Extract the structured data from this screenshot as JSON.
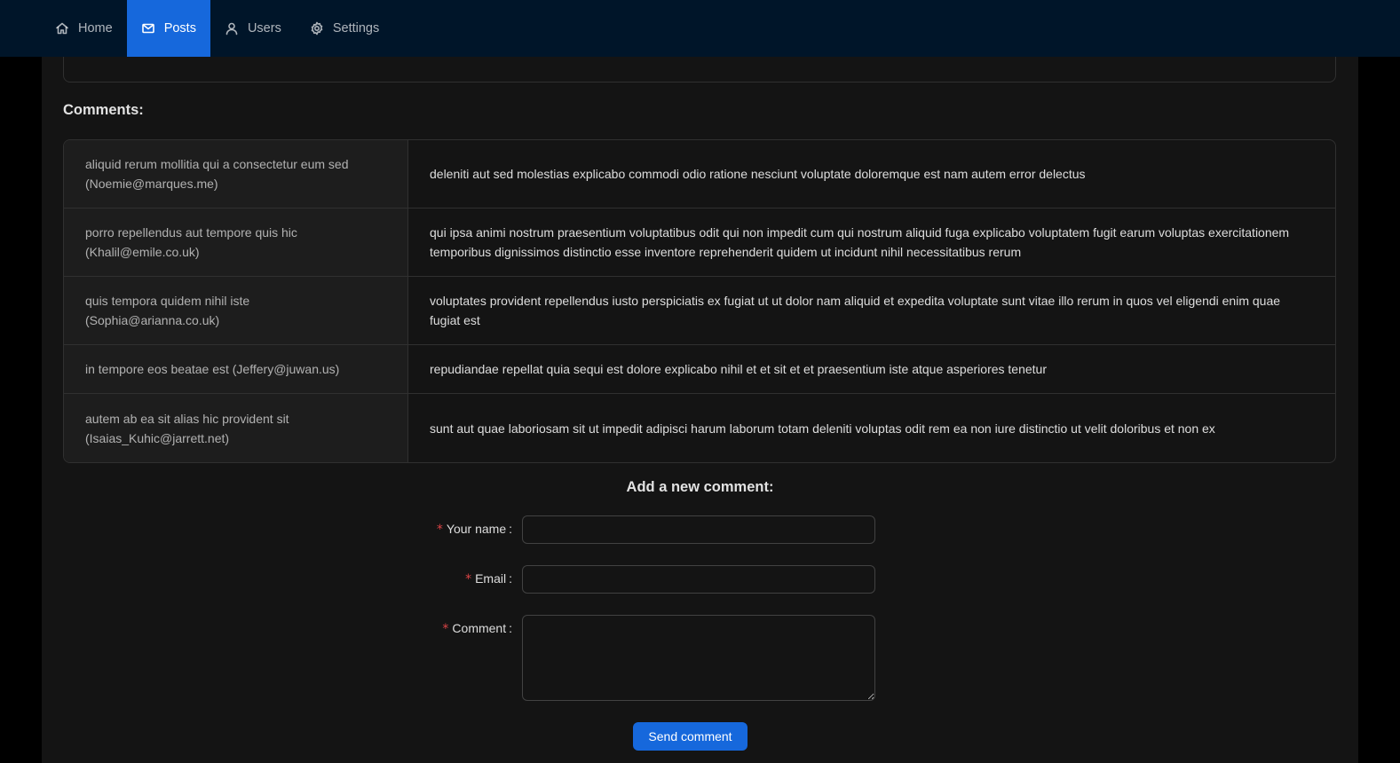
{
  "nav": {
    "items": [
      {
        "label": "Home",
        "icon": "home-icon",
        "active": false
      },
      {
        "label": "Posts",
        "icon": "mail-icon",
        "active": true
      },
      {
        "label": "Users",
        "icon": "user-icon",
        "active": false
      },
      {
        "label": "Settings",
        "icon": "gear-icon",
        "active": false
      }
    ],
    "active_color": "#1668dc",
    "background": "#001529"
  },
  "comments": {
    "title": "Comments:",
    "rows": [
      {
        "author": "aliquid rerum mollitia qui a consectetur eum sed (Noemie@marques.me)",
        "body": "deleniti aut sed molestias explicabo commodi odio ratione nesciunt voluptate doloremque est nam autem error delectus"
      },
      {
        "author": "porro repellendus aut tempore quis hic (Khalil@emile.co.uk)",
        "body": "qui ipsa animi nostrum praesentium voluptatibus odit qui non impedit cum qui nostrum aliquid fuga explicabo voluptatem fugit earum voluptas exercitationem temporibus dignissimos distinctio esse inventore reprehenderit quidem ut incidunt nihil necessitatibus rerum"
      },
      {
        "author": "quis tempora quidem nihil iste (Sophia@arianna.co.uk)",
        "body": "voluptates provident repellendus iusto perspiciatis ex fugiat ut ut dolor nam aliquid et expedita voluptate sunt vitae illo rerum in quos vel eligendi enim quae fugiat est"
      },
      {
        "author": "in tempore eos beatae est (Jeffery@juwan.us)",
        "body": "repudiandae repellat quia sequi est dolore explicabo nihil et et sit et et praesentium iste atque asperiores tenetur"
      },
      {
        "author": "autem ab ea sit alias hic provident sit (Isaias_Kuhic@jarrett.net)",
        "body": "sunt aut quae laboriosam sit ut impedit adipisci harum laborum totam deleniti voluptas odit rem ea non iure distinctio ut velit doloribus et non ex"
      }
    ]
  },
  "form": {
    "title": "Add a new comment:",
    "required_mark": "*",
    "name_label": "Your name",
    "name_value": "",
    "email_label": "Email",
    "email_value": "",
    "comment_label": "Comment",
    "comment_value": "",
    "colon": ":",
    "submit_label": "Send comment"
  }
}
